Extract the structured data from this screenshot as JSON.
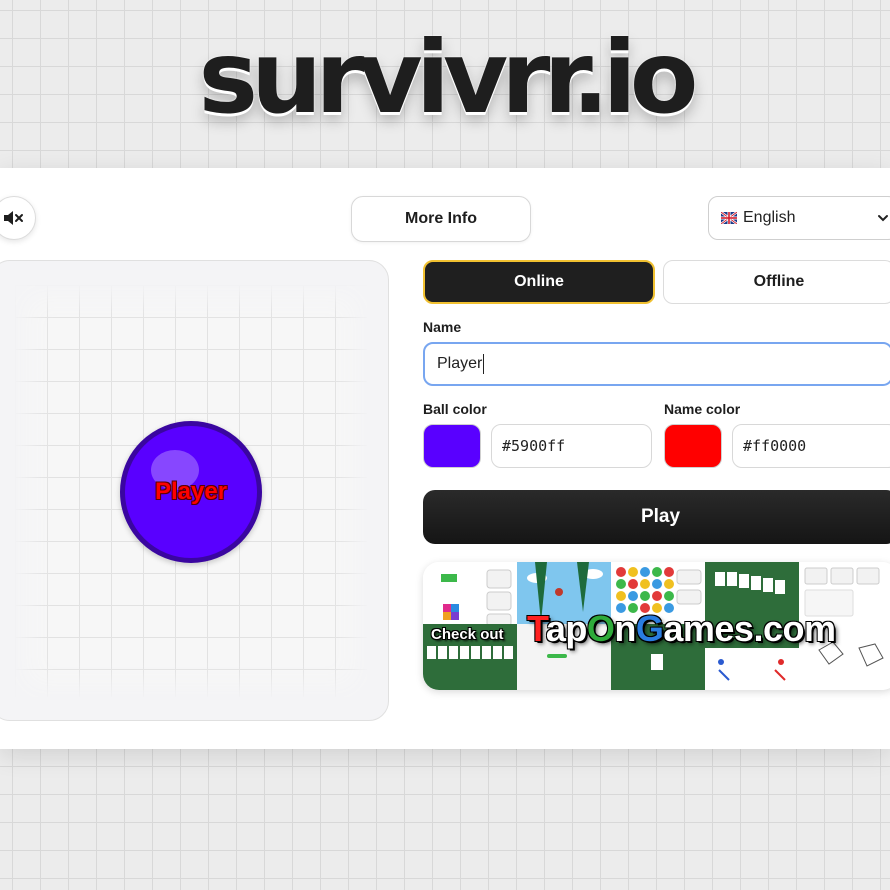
{
  "app": {
    "title": "survivrr.io"
  },
  "toolbar": {
    "mute_icon": "speaker-muted-icon",
    "more_info_label": "More Info",
    "language": {
      "flag_icon": "uk-flag-icon",
      "selected": "English"
    }
  },
  "preview": {
    "player_name": "Player",
    "ball_color": "#5900ff",
    "name_color": "#ff0000"
  },
  "modes": {
    "online_label": "Online",
    "offline_label": "Offline",
    "active": "Online"
  },
  "form": {
    "name_label": "Name",
    "name_value": "Player",
    "ball_color_label": "Ball color",
    "ball_color_value": "#5900ff",
    "name_color_label": "Name color",
    "name_color_value": "#ff0000"
  },
  "play_label": "Play",
  "promo": {
    "prefix": "Check out",
    "site_parts": [
      {
        "text": "T",
        "color": "#ff2020"
      },
      {
        "text": "ap",
        "color": "#ffffff"
      },
      {
        "text": "O",
        "color": "#2eaa3a"
      },
      {
        "text": "n",
        "color": "#ffffff"
      },
      {
        "text": "G",
        "color": "#2a7de0"
      },
      {
        "text": "ames.com",
        "color": "#ffffff"
      }
    ]
  },
  "colors": {
    "accent_border": "#f0c030",
    "focus_border": "#78a6f0",
    "dark_button": "#1f1f1f"
  }
}
